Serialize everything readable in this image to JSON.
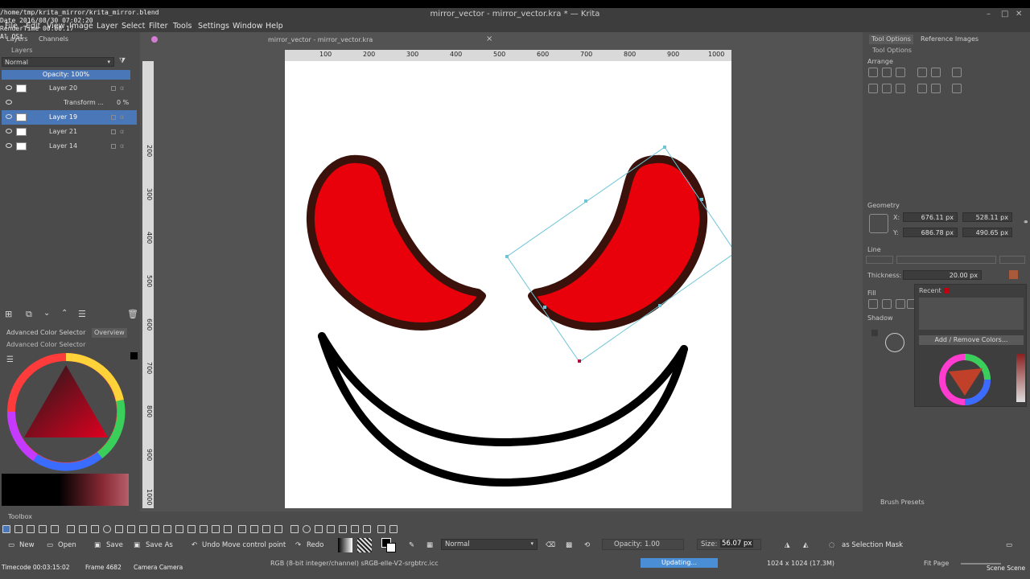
{
  "window": {
    "title": "mirror_vector - mirror_vector.kra * — Krita",
    "minimize": "–",
    "restore": "□",
    "close": "✕"
  },
  "overlay": {
    "line1": "/home/tmp/krita_mirror/krita_mirror.blend",
    "line2": "Date 2016/08/30 07:02:20",
    "line3": "RenderTime 00:00.17",
    "line4": "Al OSt"
  },
  "menu": [
    "File",
    "Edit",
    "View",
    "Image",
    "Layer",
    "Select",
    "Filter",
    "Tools",
    "Settings",
    "Window",
    "Help"
  ],
  "left_dock": {
    "tabs": [
      "Layers",
      "Channels"
    ],
    "panel_title": "Layers",
    "blend_mode": "Normal",
    "opacity_label": "Opacity: 100%",
    "layers": [
      {
        "name": "Layer 20",
        "selected": false,
        "indent": false
      },
      {
        "name": "Transform ...",
        "selected": false,
        "indent": true,
        "value": "0 %"
      },
      {
        "name": "Layer 19",
        "selected": true,
        "indent": false
      },
      {
        "name": "Layer 21",
        "selected": false,
        "indent": false
      },
      {
        "name": "Layer 14",
        "selected": false,
        "indent": false
      }
    ],
    "color_tabs": [
      "Advanced Color Selector",
      "Overview"
    ],
    "color_panel_title": "Advanced Color Selector"
  },
  "document": {
    "tab_title": "mirror_vector - mirror_vector.kra",
    "close": "×",
    "ruler_h": [
      "100",
      "200",
      "300",
      "400",
      "500",
      "600",
      "700",
      "800",
      "900",
      "1000"
    ],
    "ruler_v": [
      "200",
      "300",
      "400",
      "500",
      "600",
      "700",
      "800",
      "900",
      "1000"
    ]
  },
  "right_dock": {
    "tabs": [
      "Tool Options",
      "Reference Images"
    ],
    "panel_title": "Tool Options",
    "arrange_label": "Arrange",
    "geometry_label": "Geometry",
    "x_label": "X:",
    "y_label": "Y:",
    "x_value": "676.11 px",
    "y_value": "686.78 px",
    "w_value": "528.11 px",
    "h_value": "490.65 px",
    "line_label": "Line",
    "thickness_label": "Thickness:",
    "thickness_value": "20.00 px",
    "fill_label": "Fill",
    "shadow_label": "Shadow",
    "recent_label": "Recent",
    "add_remove_colors": "Add / Remove Colors...",
    "brush_presets": "Brush Presets"
  },
  "toolbar": {
    "label": "Toolbox",
    "new": "New",
    "open": "Open",
    "save": "Save",
    "save_as": "Save As",
    "undo": "Undo Move control point",
    "redo": "Redo",
    "blend_mode": "Normal",
    "opacity_label": "Opacity:",
    "opacity_value": "1.00",
    "size_label": "Size:",
    "size_value": "56.07 px",
    "selection_mask": "as Selection Mask"
  },
  "status": {
    "timecode": "Timecode 00:03:15:02",
    "frame": "Frame 4682",
    "camera": "Camera Camera",
    "color_info": "RGB (8-bit integer/channel)  sRGB-elle-V2-srgbtrc.icc",
    "updating": "Updating...",
    "dimensions": "1024 x 1024 (17.3M)",
    "fit_page": "Fit Page",
    "scene": "Scene Scene"
  },
  "colors": {
    "eye_fill": "#e8000b",
    "eye_stroke": "#3b120b",
    "mouth_stroke": "#000000",
    "selection_outline": "#6ec5d8",
    "accent": "#4a77b8",
    "bg": "#4b4b4b"
  }
}
